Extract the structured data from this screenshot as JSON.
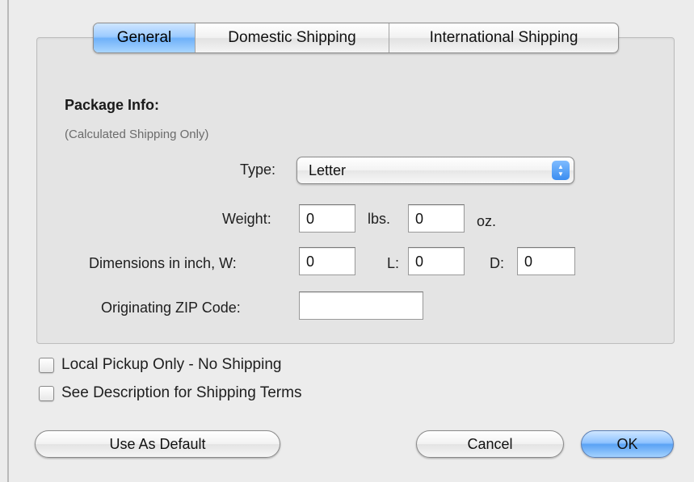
{
  "tabs": [
    {
      "label": "General",
      "active": true
    },
    {
      "label": "Domestic Shipping",
      "active": false
    },
    {
      "label": "International Shipping",
      "active": false
    }
  ],
  "package_info": {
    "title": "Package Info:",
    "subtitle": "(Calculated Shipping Only)"
  },
  "type": {
    "label": "Type:",
    "value": "Letter"
  },
  "weight": {
    "label": "Weight:",
    "lbs_value": "0",
    "lbs_unit": "lbs.",
    "oz_value": "0",
    "oz_unit": "oz."
  },
  "dimensions": {
    "label": "Dimensions in inch, W:",
    "w_value": "0",
    "l_label": "L:",
    "l_value": "0",
    "d_label": "D:",
    "d_value": "0"
  },
  "zip": {
    "label": "Originating ZIP Code:",
    "value": ""
  },
  "checkboxes": [
    {
      "label": "Local Pickup Only - No Shipping",
      "checked": false
    },
    {
      "label": "See Description for Shipping Terms",
      "checked": false
    }
  ],
  "buttons": {
    "use_default": "Use As Default",
    "cancel": "Cancel",
    "ok": "OK"
  },
  "colors": {
    "accent": "#6fb1f9",
    "background": "#ececec"
  }
}
